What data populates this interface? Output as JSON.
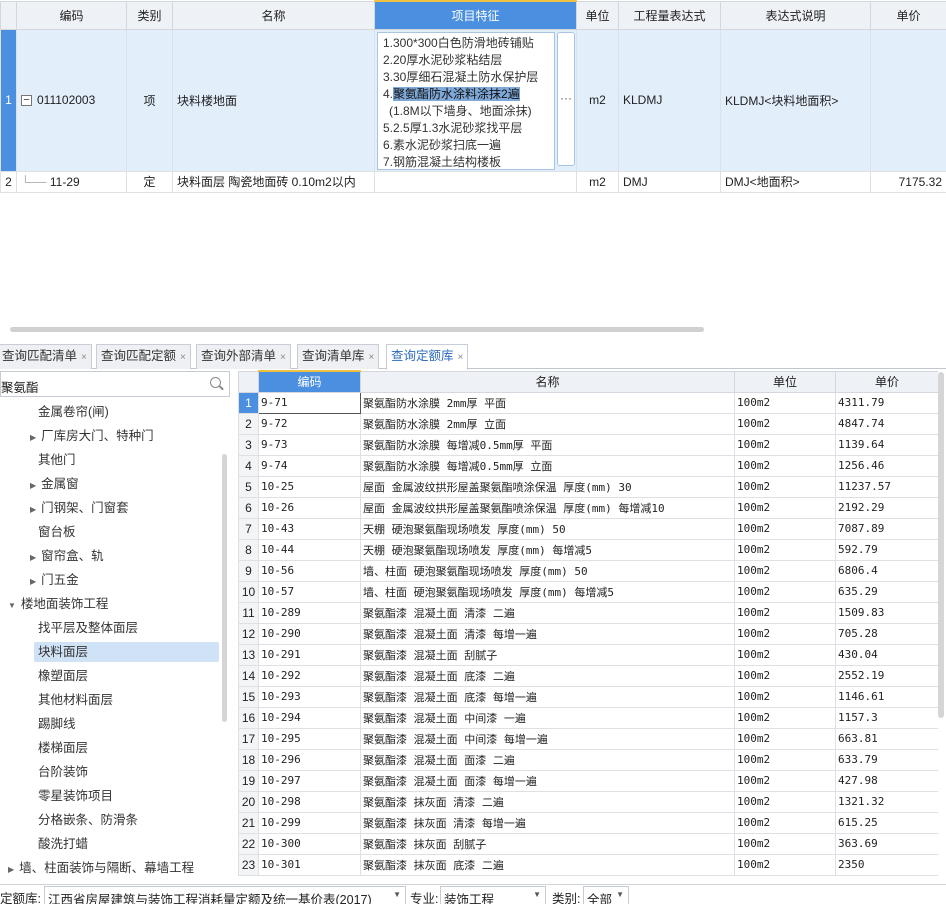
{
  "top_grid": {
    "columns": [
      "编码",
      "类别",
      "名称",
      "项目特征",
      "单位",
      "工程量表达式",
      "表达式说明",
      "单价"
    ],
    "row1": {
      "num": "1",
      "tree": "−",
      "code": "011102003",
      "type": "项",
      "name": "块料楼地面",
      "features": [
        "1.300*300白色防滑地砖铺贴",
        "2.20厚水泥砂浆粘结层",
        "3.30厚细石混凝土防水保护层",
        "4.",
        "(1.8M以下墙身、地面涂抹)",
        "5.2.5厚1.3水泥砂浆找平层",
        "6.素水泥砂浆扫底一遍",
        "7.钢筋混凝土结构楼板"
      ],
      "feature_highlight": "聚氨酯防水涂料涂抹2遍",
      "dots": "···",
      "unit": "m2",
      "expr": "KLDMJ",
      "expr_desc": "KLDMJ<块料地面积>",
      "price": ""
    },
    "row2": {
      "num": "2",
      "code": "11-29",
      "type": "定",
      "name": "块料面层 陶瓷地面砖 0.10m2以内",
      "features": "",
      "unit": "m2",
      "expr": "DMJ",
      "expr_desc": "DMJ<地面积>",
      "price": "7175.32"
    }
  },
  "tabs": [
    {
      "label": "查询匹配清单",
      "close": "×"
    },
    {
      "label": "查询匹配定额",
      "close": "×"
    },
    {
      "label": "查询外部清单",
      "close": "×"
    },
    {
      "label": "查询清单库",
      "close": "×"
    },
    {
      "label": "查询定额库",
      "close": "×"
    }
  ],
  "search": {
    "value": "聚氨酯"
  },
  "tree": [
    "金属卷帘(闸)",
    "厂库房大门、特种门",
    "其他门",
    "金属窗",
    "门钢架、门窗套",
    "窗台板",
    "窗帘盒、轨",
    "门五金",
    "楼地面装饰工程",
    "找平层及整体面层",
    "块料面层",
    "橡塑面层",
    "其他材料面层",
    "踢脚线",
    "楼梯面层",
    "台阶装饰",
    "零星装饰项目",
    "分格嵌条、防滑条",
    "酸洗打蜡",
    "墙、柱面装饰与隔断、幕墙工程"
  ],
  "quota_grid": {
    "columns": [
      "编码",
      "名称",
      "单位",
      "单价"
    ],
    "rows": [
      {
        "n": "1",
        "code": "9-71",
        "name": "聚氨酯防水涂膜 2mm厚 平面",
        "unit": "100m2",
        "price": "4311.79"
      },
      {
        "n": "2",
        "code": "9-72",
        "name": "聚氨酯防水涂膜 2mm厚 立面",
        "unit": "100m2",
        "price": "4847.74"
      },
      {
        "n": "3",
        "code": "9-73",
        "name": "聚氨酯防水涂膜 每增减0.5mm厚 平面",
        "unit": "100m2",
        "price": "1139.64"
      },
      {
        "n": "4",
        "code": "9-74",
        "name": "聚氨酯防水涂膜 每增减0.5mm厚 立面",
        "unit": "100m2",
        "price": "1256.46"
      },
      {
        "n": "5",
        "code": "10-25",
        "name": "屋面 金属波纹拱形屋盖聚氨酯喷涂保温 厚度(mm) 30",
        "unit": "100m2",
        "price": "11237.57"
      },
      {
        "n": "6",
        "code": "10-26",
        "name": "屋面 金属波纹拱形屋盖聚氨酯喷涂保温 厚度(mm) 每增减10",
        "unit": "100m2",
        "price": "2192.29"
      },
      {
        "n": "7",
        "code": "10-43",
        "name": "天棚 硬泡聚氨酯现场喷发 厚度(mm) 50",
        "unit": "100m2",
        "price": "7087.89"
      },
      {
        "n": "8",
        "code": "10-44",
        "name": "天棚 硬泡聚氨酯现场喷发 厚度(mm) 每增减5",
        "unit": "100m2",
        "price": "592.79"
      },
      {
        "n": "9",
        "code": "10-56",
        "name": "墙、柱面 硬泡聚氨酯现场喷发 厚度(mm) 50",
        "unit": "100m2",
        "price": "6806.4"
      },
      {
        "n": "10",
        "code": "10-57",
        "name": "墙、柱面 硬泡聚氨酯现场喷发 厚度(mm) 每增减5",
        "unit": "100m2",
        "price": "635.29"
      },
      {
        "n": "11",
        "code": "10-289",
        "name": "聚氨酯漆 混凝土面 清漆 二遍",
        "unit": "100m2",
        "price": "1509.83"
      },
      {
        "n": "12",
        "code": "10-290",
        "name": "聚氨酯漆 混凝土面 清漆 每增一遍",
        "unit": "100m2",
        "price": "705.28"
      },
      {
        "n": "13",
        "code": "10-291",
        "name": "聚氨酯漆 混凝土面 刮腻子",
        "unit": "100m2",
        "price": "430.04"
      },
      {
        "n": "14",
        "code": "10-292",
        "name": "聚氨酯漆 混凝土面 底漆 二遍",
        "unit": "100m2",
        "price": "2552.19"
      },
      {
        "n": "15",
        "code": "10-293",
        "name": "聚氨酯漆 混凝土面 底漆 每增一遍",
        "unit": "100m2",
        "price": "1146.61"
      },
      {
        "n": "16",
        "code": "10-294",
        "name": "聚氨酯漆 混凝土面 中间漆 一遍",
        "unit": "100m2",
        "price": "1157.3"
      },
      {
        "n": "17",
        "code": "10-295",
        "name": "聚氨酯漆 混凝土面 中间漆 每增一遍",
        "unit": "100m2",
        "price": "663.81"
      },
      {
        "n": "18",
        "code": "10-296",
        "name": "聚氨酯漆 混凝土面 面漆 二遍",
        "unit": "100m2",
        "price": "633.79"
      },
      {
        "n": "19",
        "code": "10-297",
        "name": "聚氨酯漆 混凝土面 面漆 每增一遍",
        "unit": "100m2",
        "price": "427.98"
      },
      {
        "n": "20",
        "code": "10-298",
        "name": "聚氨酯漆 抹灰面 清漆 二遍",
        "unit": "100m2",
        "price": "1321.32"
      },
      {
        "n": "21",
        "code": "10-299",
        "name": "聚氨酯漆 抹灰面 清漆 每增一遍",
        "unit": "100m2",
        "price": "615.25"
      },
      {
        "n": "22",
        "code": "10-300",
        "name": "聚氨酯漆 抹灰面 刮腻子",
        "unit": "100m2",
        "price": "363.69"
      },
      {
        "n": "23",
        "code": "10-301",
        "name": "聚氨酯漆 抹灰面 底漆 二遍",
        "unit": "100m2",
        "price": "2350"
      }
    ]
  },
  "bottom": {
    "quota_lib_label": "定额库:",
    "quota_lib_value": "江西省房屋建筑与装饰工程消耗量定额及统一基价表(2017)",
    "major_label": "专业:",
    "major_value": "装饰工程",
    "category_label": "类别:",
    "category_value": "全部"
  },
  "colors": {
    "header_active": "#4a8fe0",
    "row_selected": "#e3eefb",
    "tree_selected": "#cfe2f6"
  }
}
